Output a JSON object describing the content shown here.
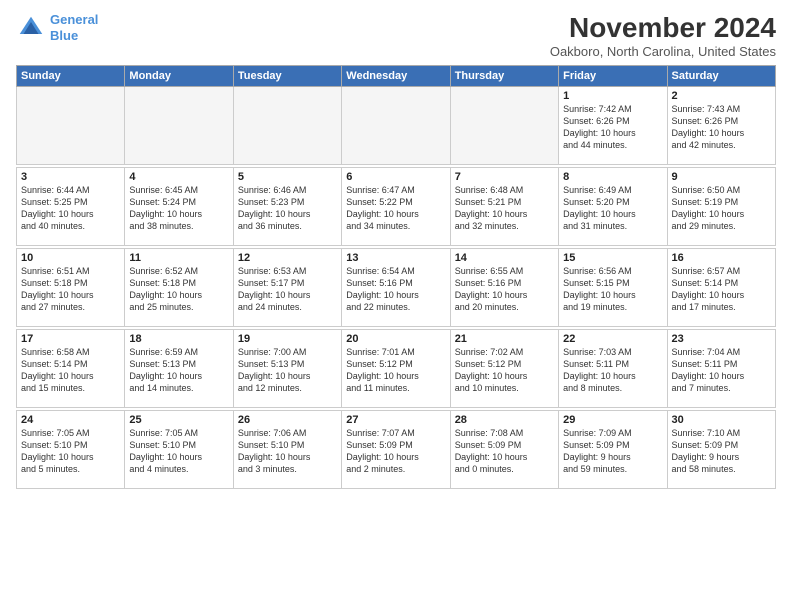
{
  "header": {
    "logo_line1": "General",
    "logo_line2": "Blue",
    "title": "November 2024",
    "location": "Oakboro, North Carolina, United States"
  },
  "weekdays": [
    "Sunday",
    "Monday",
    "Tuesday",
    "Wednesday",
    "Thursday",
    "Friday",
    "Saturday"
  ],
  "weeks": [
    [
      {
        "day": "",
        "info": ""
      },
      {
        "day": "",
        "info": ""
      },
      {
        "day": "",
        "info": ""
      },
      {
        "day": "",
        "info": ""
      },
      {
        "day": "",
        "info": ""
      },
      {
        "day": "1",
        "info": "Sunrise: 7:42 AM\nSunset: 6:26 PM\nDaylight: 10 hours\nand 44 minutes."
      },
      {
        "day": "2",
        "info": "Sunrise: 7:43 AM\nSunset: 6:26 PM\nDaylight: 10 hours\nand 42 minutes."
      }
    ],
    [
      {
        "day": "3",
        "info": "Sunrise: 6:44 AM\nSunset: 5:25 PM\nDaylight: 10 hours\nand 40 minutes."
      },
      {
        "day": "4",
        "info": "Sunrise: 6:45 AM\nSunset: 5:24 PM\nDaylight: 10 hours\nand 38 minutes."
      },
      {
        "day": "5",
        "info": "Sunrise: 6:46 AM\nSunset: 5:23 PM\nDaylight: 10 hours\nand 36 minutes."
      },
      {
        "day": "6",
        "info": "Sunrise: 6:47 AM\nSunset: 5:22 PM\nDaylight: 10 hours\nand 34 minutes."
      },
      {
        "day": "7",
        "info": "Sunrise: 6:48 AM\nSunset: 5:21 PM\nDaylight: 10 hours\nand 32 minutes."
      },
      {
        "day": "8",
        "info": "Sunrise: 6:49 AM\nSunset: 5:20 PM\nDaylight: 10 hours\nand 31 minutes."
      },
      {
        "day": "9",
        "info": "Sunrise: 6:50 AM\nSunset: 5:19 PM\nDaylight: 10 hours\nand 29 minutes."
      }
    ],
    [
      {
        "day": "10",
        "info": "Sunrise: 6:51 AM\nSunset: 5:18 PM\nDaylight: 10 hours\nand 27 minutes."
      },
      {
        "day": "11",
        "info": "Sunrise: 6:52 AM\nSunset: 5:18 PM\nDaylight: 10 hours\nand 25 minutes."
      },
      {
        "day": "12",
        "info": "Sunrise: 6:53 AM\nSunset: 5:17 PM\nDaylight: 10 hours\nand 24 minutes."
      },
      {
        "day": "13",
        "info": "Sunrise: 6:54 AM\nSunset: 5:16 PM\nDaylight: 10 hours\nand 22 minutes."
      },
      {
        "day": "14",
        "info": "Sunrise: 6:55 AM\nSunset: 5:16 PM\nDaylight: 10 hours\nand 20 minutes."
      },
      {
        "day": "15",
        "info": "Sunrise: 6:56 AM\nSunset: 5:15 PM\nDaylight: 10 hours\nand 19 minutes."
      },
      {
        "day": "16",
        "info": "Sunrise: 6:57 AM\nSunset: 5:14 PM\nDaylight: 10 hours\nand 17 minutes."
      }
    ],
    [
      {
        "day": "17",
        "info": "Sunrise: 6:58 AM\nSunset: 5:14 PM\nDaylight: 10 hours\nand 15 minutes."
      },
      {
        "day": "18",
        "info": "Sunrise: 6:59 AM\nSunset: 5:13 PM\nDaylight: 10 hours\nand 14 minutes."
      },
      {
        "day": "19",
        "info": "Sunrise: 7:00 AM\nSunset: 5:13 PM\nDaylight: 10 hours\nand 12 minutes."
      },
      {
        "day": "20",
        "info": "Sunrise: 7:01 AM\nSunset: 5:12 PM\nDaylight: 10 hours\nand 11 minutes."
      },
      {
        "day": "21",
        "info": "Sunrise: 7:02 AM\nSunset: 5:12 PM\nDaylight: 10 hours\nand 10 minutes."
      },
      {
        "day": "22",
        "info": "Sunrise: 7:03 AM\nSunset: 5:11 PM\nDaylight: 10 hours\nand 8 minutes."
      },
      {
        "day": "23",
        "info": "Sunrise: 7:04 AM\nSunset: 5:11 PM\nDaylight: 10 hours\nand 7 minutes."
      }
    ],
    [
      {
        "day": "24",
        "info": "Sunrise: 7:05 AM\nSunset: 5:10 PM\nDaylight: 10 hours\nand 5 minutes."
      },
      {
        "day": "25",
        "info": "Sunrise: 7:05 AM\nSunset: 5:10 PM\nDaylight: 10 hours\nand 4 minutes."
      },
      {
        "day": "26",
        "info": "Sunrise: 7:06 AM\nSunset: 5:10 PM\nDaylight: 10 hours\nand 3 minutes."
      },
      {
        "day": "27",
        "info": "Sunrise: 7:07 AM\nSunset: 5:09 PM\nDaylight: 10 hours\nand 2 minutes."
      },
      {
        "day": "28",
        "info": "Sunrise: 7:08 AM\nSunset: 5:09 PM\nDaylight: 10 hours\nand 0 minutes."
      },
      {
        "day": "29",
        "info": "Sunrise: 7:09 AM\nSunset: 5:09 PM\nDaylight: 9 hours\nand 59 minutes."
      },
      {
        "day": "30",
        "info": "Sunrise: 7:10 AM\nSunset: 5:09 PM\nDaylight: 9 hours\nand 58 minutes."
      }
    ]
  ]
}
